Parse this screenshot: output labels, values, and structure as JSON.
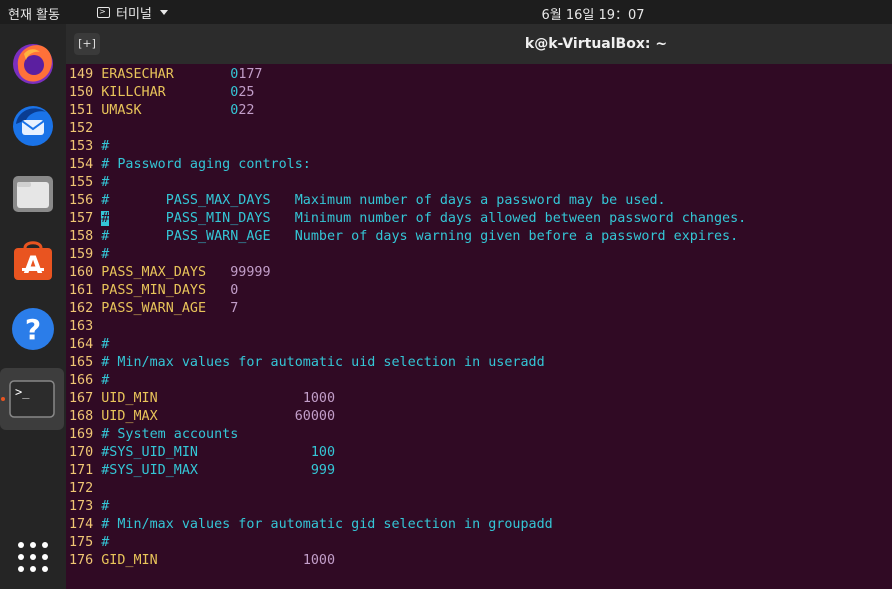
{
  "topbar": {
    "activities": "현재 활동",
    "app_name": "터미널",
    "clock": "6월 16일  19：07"
  },
  "dock": {
    "items": [
      {
        "name": "firefox"
      },
      {
        "name": "thunderbird"
      },
      {
        "name": "files"
      },
      {
        "name": "software"
      },
      {
        "name": "help"
      },
      {
        "name": "terminal",
        "active": true
      }
    ]
  },
  "terminal": {
    "title": "k@k-VirtualBox: ~",
    "lines": [
      {
        "num": "149",
        "text": " ERASECHAR       0177"
      },
      {
        "num": "150",
        "text": " KILLCHAR        025"
      },
      {
        "num": "151",
        "text": " UMASK           022"
      },
      {
        "num": "152",
        "text": ""
      },
      {
        "num": "153",
        "text": " #"
      },
      {
        "num": "154",
        "text": " # Password aging controls:"
      },
      {
        "num": "155",
        "text": " #"
      },
      {
        "num": "156",
        "text": " #       PASS_MAX_DAYS   Maximum number of days a password may be used."
      },
      {
        "num": "157",
        "text": " #       PASS_MIN_DAYS   Minimum number of days allowed between password changes."
      },
      {
        "num": "158",
        "text": " #       PASS_WARN_AGE   Number of days warning given before a password expires."
      },
      {
        "num": "159",
        "text": " #"
      },
      {
        "num": "160",
        "text": " PASS_MAX_DAYS   99999"
      },
      {
        "num": "161",
        "text": " PASS_MIN_DAYS   0"
      },
      {
        "num": "162",
        "text": " PASS_WARN_AGE   7"
      },
      {
        "num": "163",
        "text": ""
      },
      {
        "num": "164",
        "text": " #"
      },
      {
        "num": "165",
        "text": " # Min/max values for automatic uid selection in useradd"
      },
      {
        "num": "166",
        "text": " #"
      },
      {
        "num": "167",
        "text": " UID_MIN                  1000"
      },
      {
        "num": "168",
        "text": " UID_MAX                 60000"
      },
      {
        "num": "169",
        "text": " # System accounts"
      },
      {
        "num": "170",
        "text": " #SYS_UID_MIN              100"
      },
      {
        "num": "171",
        "text": " #SYS_UID_MAX              999"
      },
      {
        "num": "172",
        "text": ""
      },
      {
        "num": "173",
        "text": " #"
      },
      {
        "num": "174",
        "text": " # Min/max values for automatic gid selection in groupadd"
      },
      {
        "num": "175",
        "text": " #"
      },
      {
        "num": "176",
        "text": " GID_MIN                  1000"
      }
    ]
  },
  "colors": {
    "terminal_bg": "#300a24",
    "line_number": "#f0c674",
    "keyword": "#e8c45a",
    "comment": "#34c6d6",
    "value": "#c29ec9"
  }
}
